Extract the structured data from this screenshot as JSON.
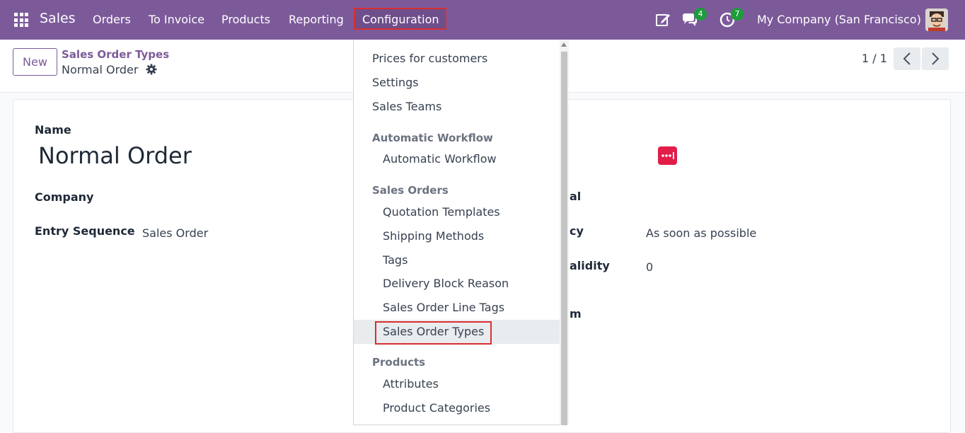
{
  "navbar": {
    "brand": "Sales",
    "menus": [
      "Orders",
      "To Invoice",
      "Products",
      "Reporting"
    ],
    "active_menu": "Configuration",
    "messages_badge": "4",
    "activities_badge": "7",
    "company": "My Company (San Francisco)",
    "icons": [
      "apps-grid-icon",
      "edit-icon",
      "chat-icon",
      "clock-icon",
      "avatar"
    ]
  },
  "control": {
    "new_button": "New",
    "breadcrumb_parent": "Sales Order Types",
    "breadcrumb_current": "Normal Order",
    "pager": "1 / 1"
  },
  "form": {
    "name_label": "Name",
    "name_value": "Normal Order",
    "company_label": "Company",
    "entry_sequence_label": "Entry Sequence",
    "entry_sequence_value": "Sales Order",
    "right_label_1": "al",
    "right_label_2": "cy",
    "right_value_2": "As soon as possible",
    "right_label_3": "alidity",
    "right_value_3": "0",
    "right_label_4": "m"
  },
  "dropdown": {
    "top_items": [
      "Prices for customers",
      "Settings",
      "Sales Teams"
    ],
    "automatic_workflow_header": "Automatic Workflow",
    "automatic_workflow_items": [
      "Automatic Workflow"
    ],
    "sales_orders_header": "Sales Orders",
    "sales_orders_items": [
      "Quotation Templates",
      "Shipping Methods",
      "Tags",
      "Delivery Block Reason",
      "Sales Order Line Tags",
      "Sales Order Types"
    ],
    "products_header": "Products",
    "products_items": [
      "Attributes",
      "Product Categories"
    ],
    "highlighted_item": "Sales Order Types"
  },
  "colors": {
    "navbar": "#7c5a9a",
    "highlight_border": "#d92f2f",
    "badge": "#1c9d3a"
  }
}
